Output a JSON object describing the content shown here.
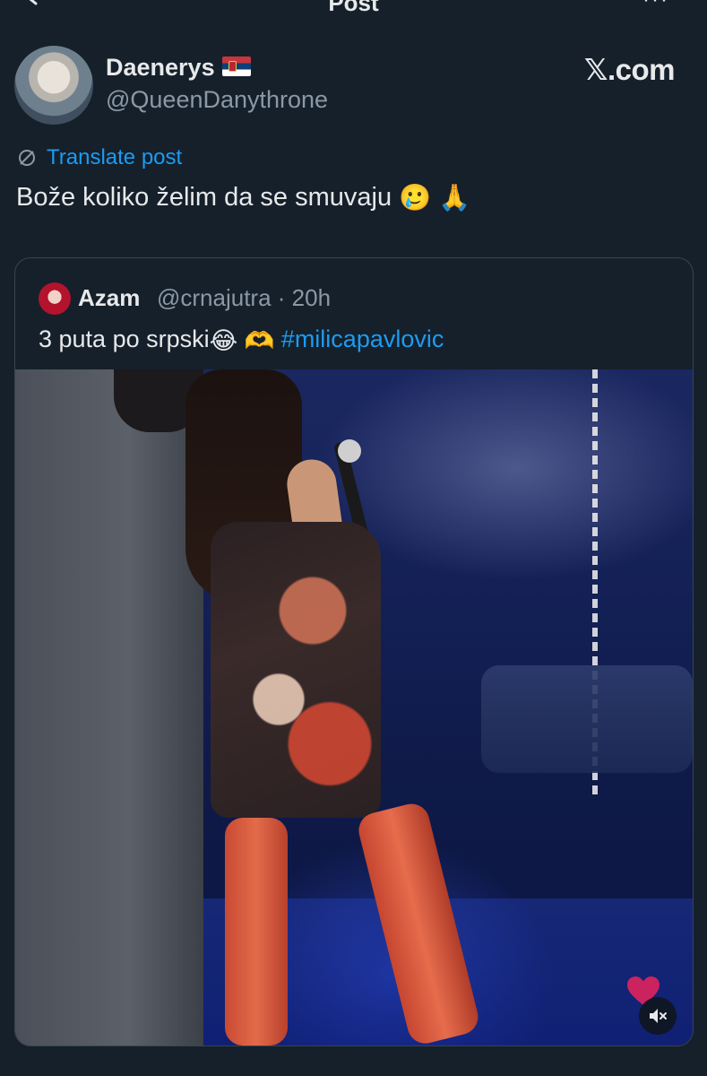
{
  "header": {
    "title": "Post",
    "more_label": "···"
  },
  "post": {
    "author_name": "Daenerys",
    "author_handle": "@QueenDanythrone",
    "brand": "𝕏.com",
    "translate_label": "Translate post",
    "text": "Bože koliko želim da se smuvaju",
    "text_emojis": "🥲 🙏"
  },
  "quoted": {
    "author_name": "Azam",
    "author_meta": "@crnajutra · 20h",
    "text": "3 puta po srpski",
    "text_emojis": "😂 🫶",
    "hashtag": "#milicapavlovic"
  },
  "media": {
    "type": "video",
    "mute_icon": "speaker-muted-icon",
    "overlay_icon": "heart-icon"
  },
  "colors": {
    "background": "#15202b",
    "link": "#1d9bf0",
    "secondary_text": "#8b98a5",
    "border": "#38444d"
  }
}
